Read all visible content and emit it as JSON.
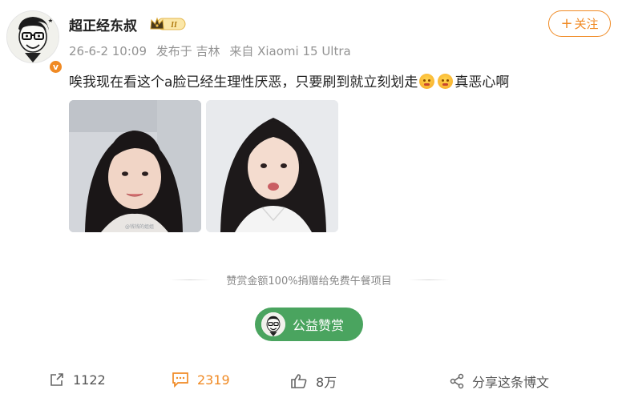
{
  "post": {
    "username": "超正经东叔",
    "member_level": "II",
    "verified_badge": "v",
    "date": "26-6-2 10:09",
    "location": "发布于 吉林",
    "device": "来自 Xiaomi 15 Ultra",
    "follow_label": "关注",
    "follow_plus": "+",
    "text_before": "唉我现在看这个a脸已经生理性厌恶，只要刷到就立刻划走",
    "text_after": "真恶心啊",
    "emoji_icon": "angry-face-emoji",
    "photos": [
      "woman-portrait-photo-1",
      "woman-portrait-photo-2"
    ],
    "photo1_watermark": "@钱钱的姐姐"
  },
  "donation": {
    "notice": "赞赏金额100%捐赠给免费午餐项目",
    "button_label": "公益赞赏"
  },
  "actions": {
    "share_count": "1122",
    "comment_count": "2319",
    "like_count": "8万",
    "share_post_label": "分享这条博文"
  },
  "colors": {
    "accent": "#f08a24",
    "donate_green": "#4aa45f",
    "meta_gray": "#939393"
  }
}
